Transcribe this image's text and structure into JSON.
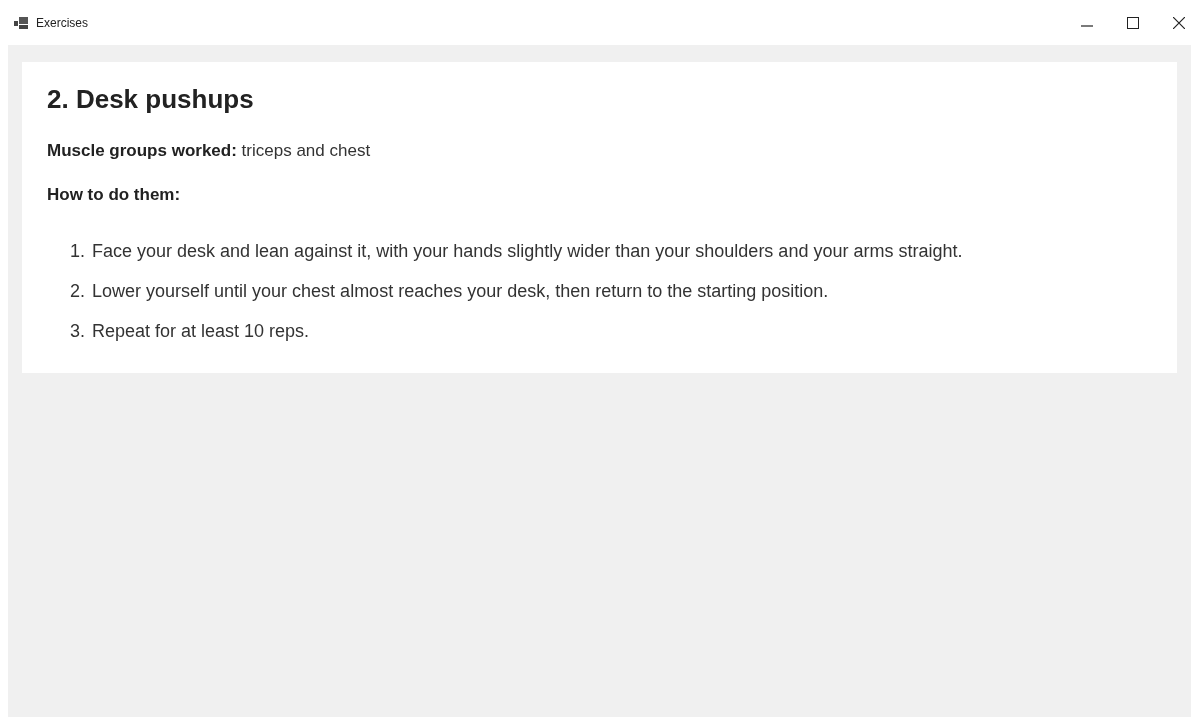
{
  "window": {
    "title": "Exercises"
  },
  "article": {
    "heading": "2. Desk pushups",
    "muscles": "**Muscle groups worked:** triceps and chest",
    "subheading": "How to do them:",
    "steps": [
      {
        "number": "1.",
        "text": "Face your desk and lean against it, with your hands slightly wider than your shoulders and your arms straight."
      },
      {
        "number": "2.",
        "text": "Lower yourself until your chest almost reaches your desk, then return to the starting position."
      },
      {
        "number": "3.",
        "text": "Repeat for at least 10 reps."
      }
    ]
  }
}
